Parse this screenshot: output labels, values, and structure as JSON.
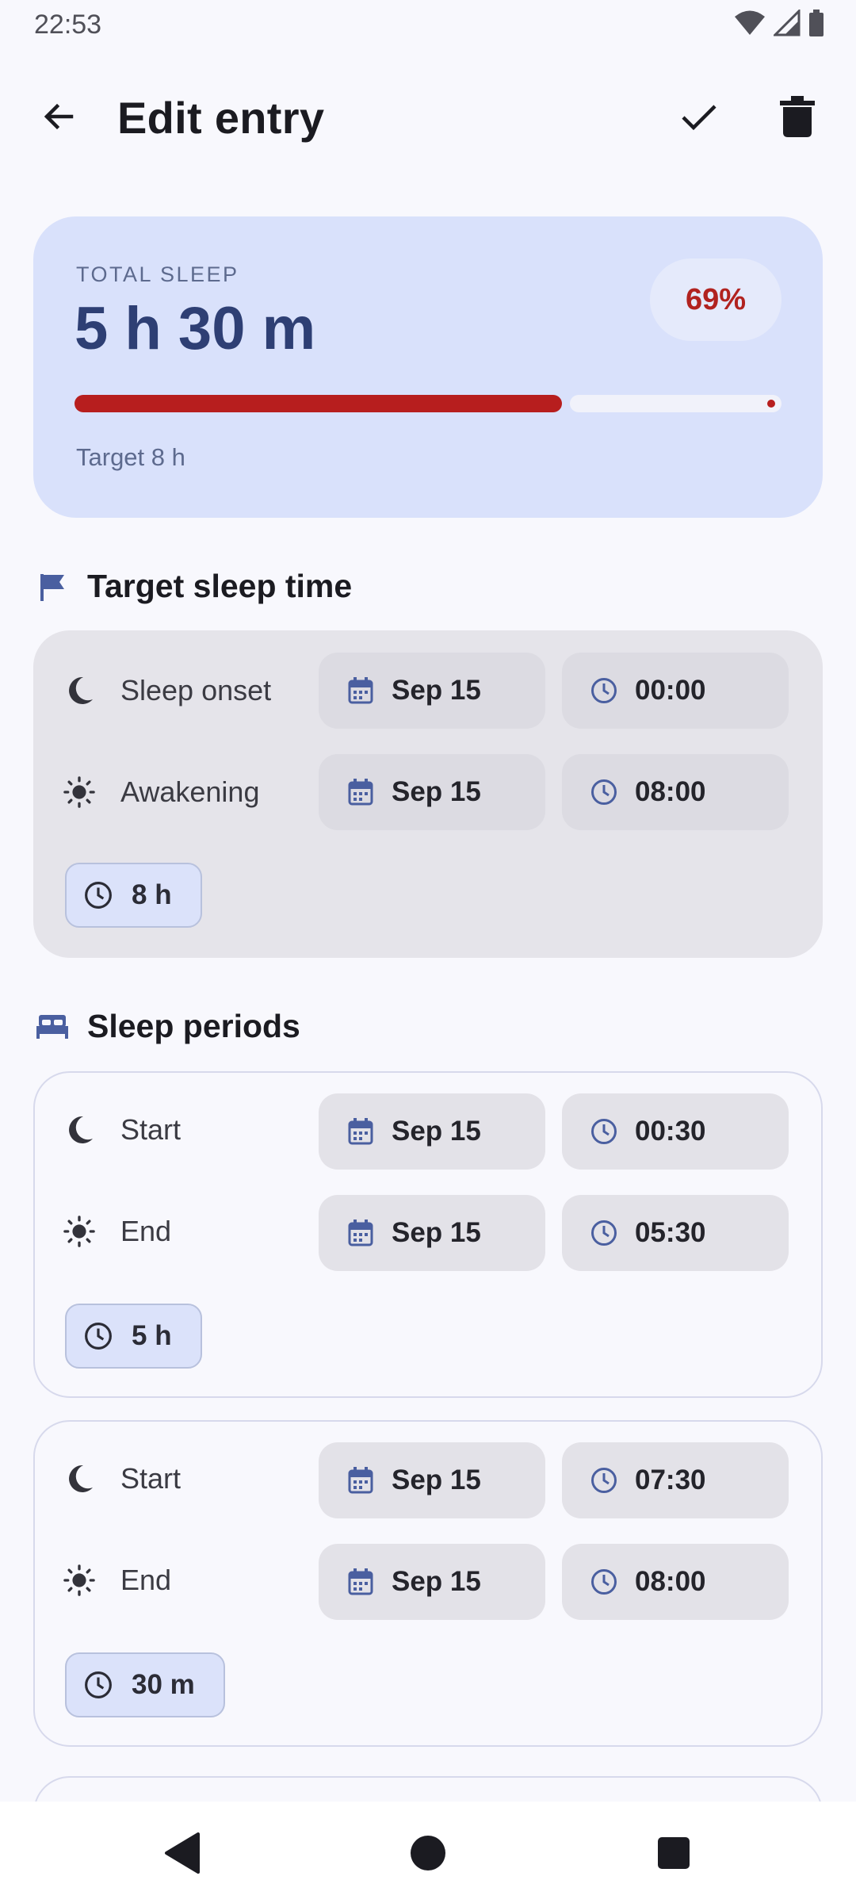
{
  "status_bar": {
    "time": "22:53"
  },
  "appbar": {
    "title": "Edit entry"
  },
  "summary": {
    "label": "TOTAL SLEEP",
    "value": "5 h 30 m",
    "percent": "69%",
    "progress_fraction": 0.69,
    "target": "Target 8 h"
  },
  "target_section": {
    "title": "Target sleep time",
    "rows": [
      {
        "label": "Sleep onset",
        "date": "Sep 15",
        "time": "00:00"
      },
      {
        "label": "Awakening",
        "date": "Sep 15",
        "time": "08:00"
      }
    ],
    "duration": "8 h"
  },
  "periods_section": {
    "title": "Sleep periods",
    "periods": [
      {
        "rows": [
          {
            "label": "Start",
            "date": "Sep 15",
            "time": "00:30"
          },
          {
            "label": "End",
            "date": "Sep 15",
            "time": "05:30"
          }
        ],
        "duration": "5 h"
      },
      {
        "rows": [
          {
            "label": "Start",
            "date": "Sep 15",
            "time": "07:30"
          },
          {
            "label": "End",
            "date": "Sep 15",
            "time": "08:00"
          }
        ],
        "duration": "30 m"
      }
    ]
  },
  "colors": {
    "accent": "#2e3f74",
    "progress": "#b71e1e",
    "summary_bg": "#d9e1fb",
    "icon_blue": "#4a5fa0"
  },
  "icons": {
    "back": "arrow-left-icon",
    "confirm": "check-icon",
    "delete": "trash-icon",
    "target_section": "flag-icon",
    "periods_section": "bed-icon",
    "start": "moon-icon",
    "end": "sun-icon",
    "date": "calendar-icon",
    "time": "clock-icon"
  }
}
